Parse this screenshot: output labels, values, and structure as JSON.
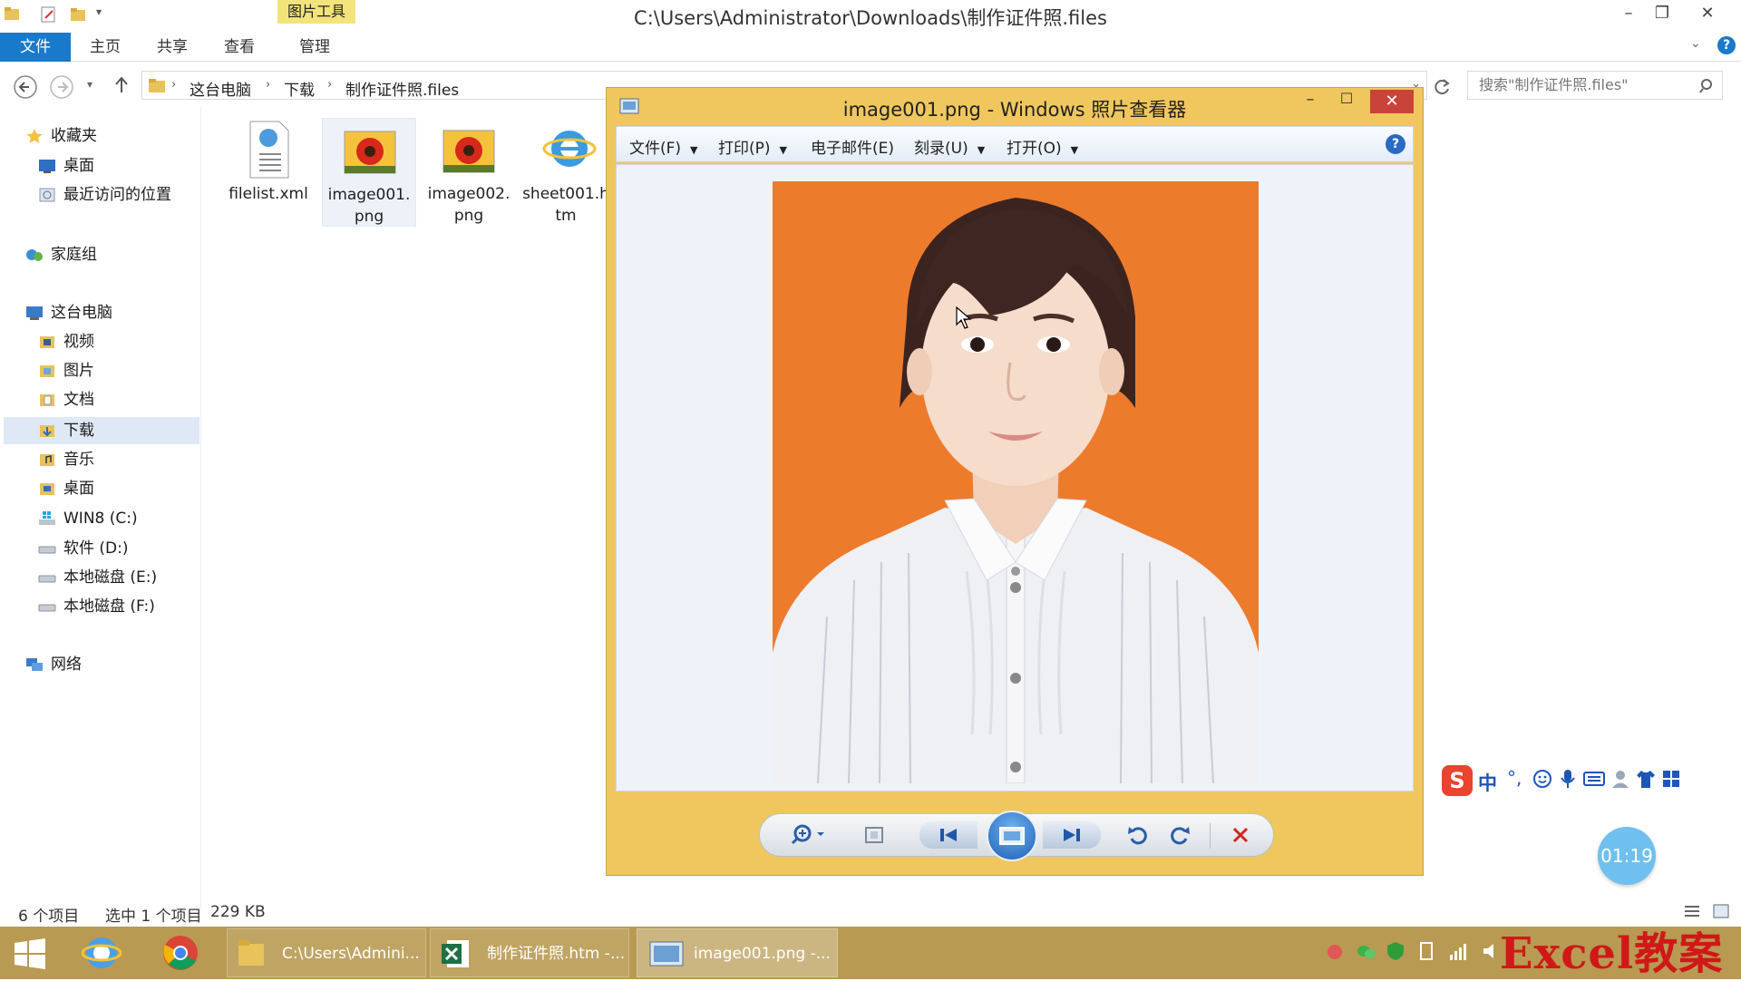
{
  "explorer": {
    "title": "C:\\Users\\Administrator\\Downloads\\制作证件照.files",
    "context_tab": "图片工具",
    "ribbon_tabs": [
      "文件",
      "主页",
      "共享",
      "查看",
      "管理"
    ],
    "breadcrumb": [
      "这台电脑",
      "下载",
      "制作证件照.files"
    ],
    "search_placeholder": "搜索\"制作证件照.files\"",
    "nav": {
      "favorites": "收藏夹",
      "favorites_items": [
        "桌面",
        "最近访问的位置"
      ],
      "homegroup": "家庭组",
      "this_pc": "这台电脑",
      "pc_items": [
        "视频",
        "图片",
        "文档",
        "下载",
        "音乐",
        "桌面",
        "WIN8 (C:)",
        "软件 (D:)",
        "本地磁盘 (E:)",
        "本地磁盘 (F:)"
      ],
      "network": "网络"
    },
    "files": [
      {
        "name": "filelist.xml",
        "line2": ""
      },
      {
        "name": "image001.",
        "line2": "png"
      },
      {
        "name": "image002.",
        "line2": "png"
      },
      {
        "name": "sheet001.h",
        "line2": "tm"
      }
    ],
    "status": {
      "count": "6 个项目",
      "selected": "选中 1 个项目",
      "size": "229 KB"
    }
  },
  "viewer": {
    "title": "image001.png - Windows 照片查看器",
    "menu": [
      "文件(F)",
      "打印(P)",
      "电子邮件(E)",
      "刻录(U)",
      "打开(O)"
    ],
    "toolbar_icons": [
      "zoom-icon",
      "actual-size-icon",
      "previous-icon",
      "slideshow-icon",
      "next-icon",
      "rotate-left-icon",
      "rotate-right-icon",
      "delete-icon"
    ]
  },
  "ime": {
    "label": "中"
  },
  "timer": "01:19",
  "taskbar": {
    "buttons": [
      "C:\\Users\\Admini...",
      "制作证件照.htm -...",
      "image001.png -..."
    ]
  },
  "watermark": "Excel教案",
  "colors": {
    "ribbon_file_tab": "#1979ca",
    "viewer_frame": "#f0c75e",
    "photo_background": "#ed7b2c",
    "taskbar": "#b89a52",
    "close_button": "#c9433a"
  }
}
